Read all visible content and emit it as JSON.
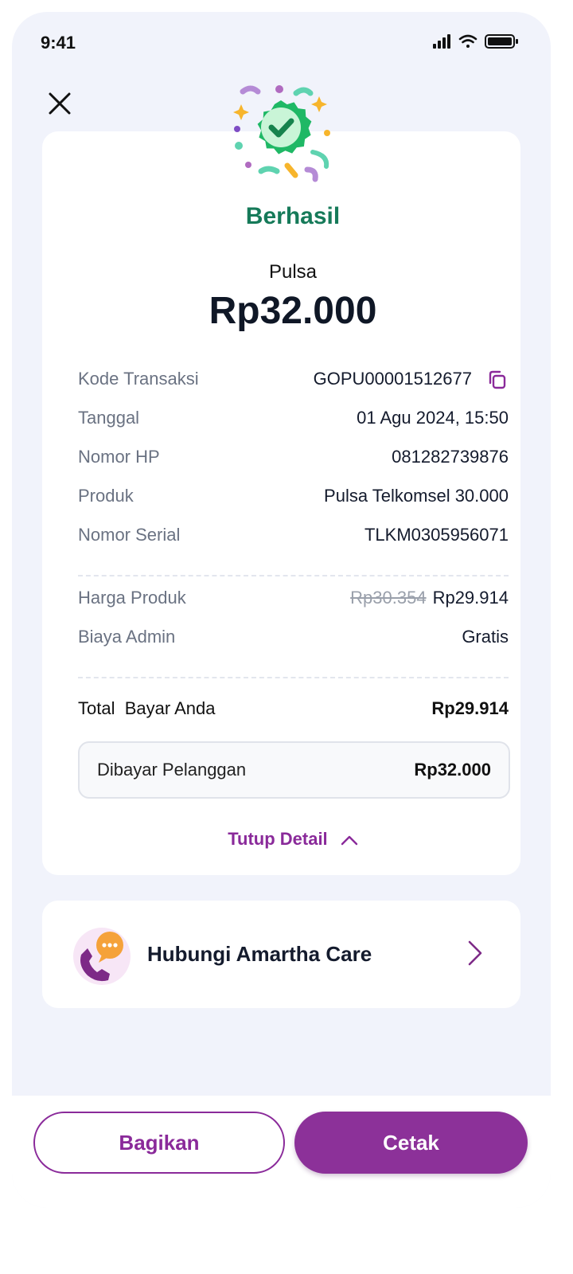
{
  "status_bar": {
    "time": "9:41"
  },
  "header": {
    "title": "Berhasil"
  },
  "summary": {
    "product": "Pulsa",
    "amount": "Rp32.000"
  },
  "details": [
    {
      "label": "Kode Transaksi",
      "value": "GOPU00001512677"
    },
    {
      "label": "Tanggal",
      "value": "01 Agu 2024, 15:50"
    },
    {
      "label": "Nomor HP",
      "value": "081282739876"
    },
    {
      "label": "Produk",
      "value": "Pulsa Telkomsel 30.000"
    },
    {
      "label": "Nomor Serial",
      "value": "TLKM0305956071"
    }
  ],
  "pricing": {
    "price_label": "Harga Produk",
    "price_original": "Rp30.354",
    "price_value": "Rp29.914",
    "admin_label": "Biaya Admin",
    "admin_value": "Gratis"
  },
  "total": {
    "label": "Total  Bayar Anda",
    "value": "Rp29.914"
  },
  "customer_paid": {
    "label": "Dibayar Pelanggan",
    "value": "Rp32.000"
  },
  "toggle_label": "Tutup Detail",
  "care": {
    "label": "Hubungi Amartha Care"
  },
  "buttons": {
    "share": "Bagikan",
    "print": "Cetak"
  },
  "colors": {
    "primary": "#8c3199",
    "success": "#167a59",
    "background": "#f1f3fb"
  }
}
